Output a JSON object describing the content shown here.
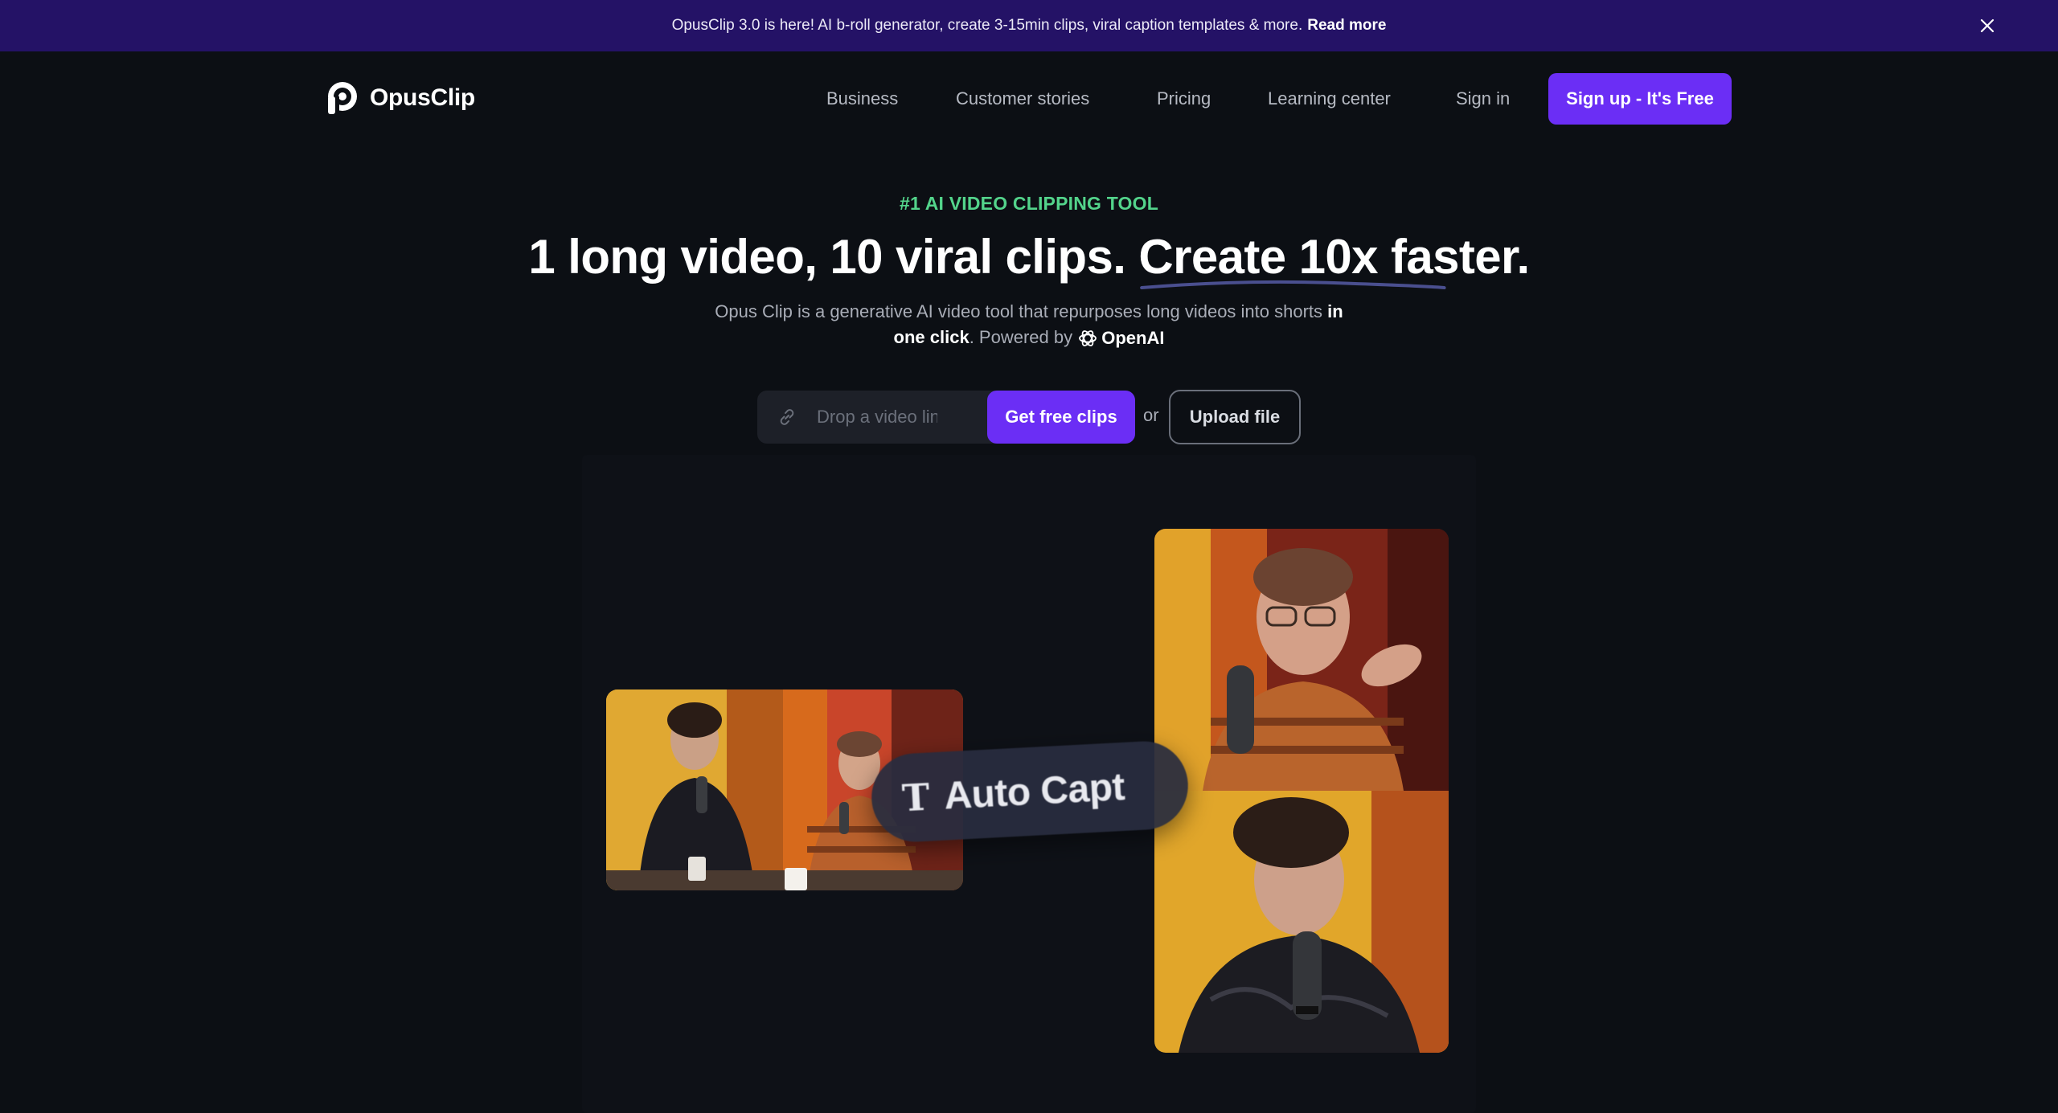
{
  "announcement": {
    "text": "OpusClip 3.0 is here! AI b-roll generator, create 3-15min clips, viral caption templates & more.",
    "link": "Read more"
  },
  "brand": {
    "name": "OpusClip"
  },
  "nav": {
    "items": [
      "Business",
      "Customer stories",
      "Pricing",
      "Learning center",
      "Sign in"
    ],
    "cta": "Sign up - It's Free"
  },
  "hero": {
    "eyebrow": "#1 AI VIDEO CLIPPING TOOL",
    "headline_part1": "1 long video, 10 viral clips.",
    "headline_part2": "Create 10x faster.",
    "sub_part1": "Opus Clip is a generative AI video tool that repurposes long videos into shorts",
    "sub_bold": "in one click",
    "sub_part2": ". Powered by",
    "powered_by": "OpenAI"
  },
  "input": {
    "placeholder": "Drop a video link",
    "value": "",
    "cta": "Get free clips",
    "or": "or",
    "upload": "Upload file"
  },
  "demo": {
    "caption_pill": "Auto Capt"
  },
  "colors": {
    "accent": "#6b2ef5",
    "announce_bg": "#241266",
    "eyebrow": "#53d48b",
    "page_bg": "#0c0f14"
  }
}
